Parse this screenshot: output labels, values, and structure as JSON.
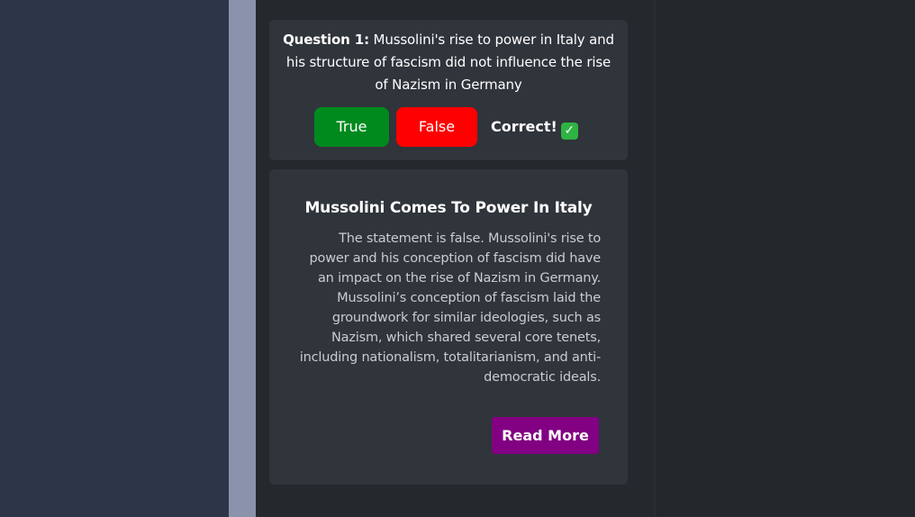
{
  "question": {
    "label": "Question 1:",
    "text": "Mussolini's rise to power in Italy and his structure of fascism did not influence the rise of Nazism in Germany",
    "answers": {
      "true_label": "True",
      "false_label": "False"
    },
    "result_text": "Correct!",
    "result_icon": "✓"
  },
  "explanation": {
    "title": "Mussolini Comes To Power In Italy",
    "body": "The statement is false. Mussolini's rise to power and his conception of fascism did have an impact on the rise of Nazism in Germany. Mussolini’s conception of fascism laid the groundwork for similar ideologies, such as Nazism, which shared several core tenets, including nationalism, totalitarianism, and anti-democratic ideals.",
    "read_more_label": "Read More"
  },
  "colors": {
    "true_button": "#008a1e",
    "false_button": "#ff0000",
    "read_more_button": "#820082",
    "check_badge": "#2fb344"
  }
}
